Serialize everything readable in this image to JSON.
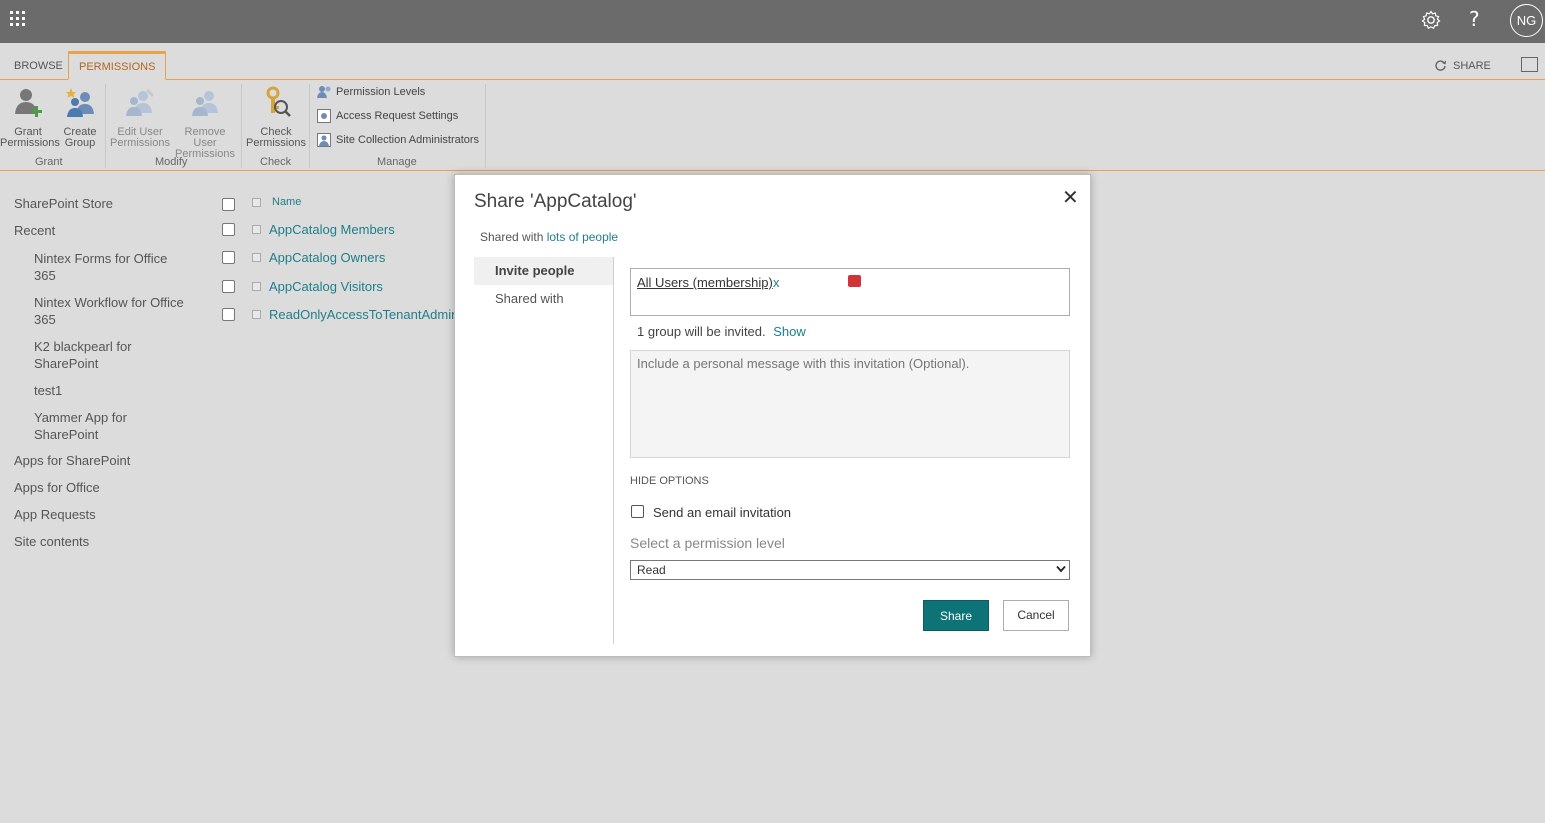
{
  "suitebar": {
    "help_glyph": "?",
    "avatar_initials": "NG",
    "icons": [
      "app-launcher-icon",
      "gear-icon",
      "help-icon"
    ]
  },
  "ribbon": {
    "tabs": [
      {
        "label": "BROWSE"
      },
      {
        "label": "PERMISSIONS"
      }
    ],
    "share_label": "SHARE",
    "groups": {
      "grant": "Grant",
      "modify": "Modify",
      "check": "Check",
      "manage": "Manage"
    },
    "buttons": {
      "grant_1": "Grant",
      "grant_2": "Permissions",
      "create_1": "Create",
      "create_2": "Group",
      "edit_1": "Edit User",
      "edit_2": "Permissions",
      "remove_1": "Remove User",
      "remove_2": "Permissions",
      "check_1": "Check",
      "check_2": "Permissions"
    },
    "manage_items": [
      {
        "label": "Permission Levels"
      },
      {
        "label": "Access Request Settings"
      },
      {
        "label": "Site Collection Administrators"
      }
    ]
  },
  "nav": {
    "items": [
      {
        "label": "SharePoint Store"
      },
      {
        "label": "Recent"
      },
      {
        "label": "Nintex Forms for Office 365"
      },
      {
        "label": "Nintex Workflow for Office 365"
      },
      {
        "label": "K2 blackpearl for SharePoint"
      },
      {
        "label": "test1"
      },
      {
        "label": "Yammer App for SharePoint"
      },
      {
        "label": "Apps for SharePoint"
      },
      {
        "label": "Apps for Office"
      },
      {
        "label": "App Requests"
      },
      {
        "label": "Site contents"
      }
    ]
  },
  "list": {
    "header": "Name",
    "rows": [
      {
        "name": "AppCatalog Members"
      },
      {
        "name": "AppCatalog Owners"
      },
      {
        "name": "AppCatalog Visitors"
      },
      {
        "name": "ReadOnlyAccessToTenantAdminS"
      }
    ]
  },
  "dialog": {
    "title": "Share 'AppCatalog'",
    "close_glyph": "✕",
    "shared_with_prefix": "Shared with",
    "shared_with_link": "lots of people",
    "side_tabs": [
      {
        "label": "Invite people",
        "selected": true
      },
      {
        "label": "Shared with",
        "selected": false
      }
    ],
    "token_label": "All Users (membership)",
    "token_remove": "x",
    "invited_text": "1 group will be invited.",
    "show_link": "Show",
    "message_placeholder": "Include a personal message with this invitation (Optional).",
    "hide_options": "HIDE OPTIONS",
    "email_checkbox_label": "Send an email invitation",
    "email_checked": false,
    "permission_label": "Select a permission level",
    "permission_value": "Read",
    "share_button": "Share",
    "cancel_button": "Cancel"
  },
  "colors": {
    "suitebar": "#6b6b6b",
    "accent_orange": "#e8a24a",
    "link_teal": "#1e7f89",
    "share_button": "#0d7377",
    "overlay_bg": "#dcdcdc"
  }
}
